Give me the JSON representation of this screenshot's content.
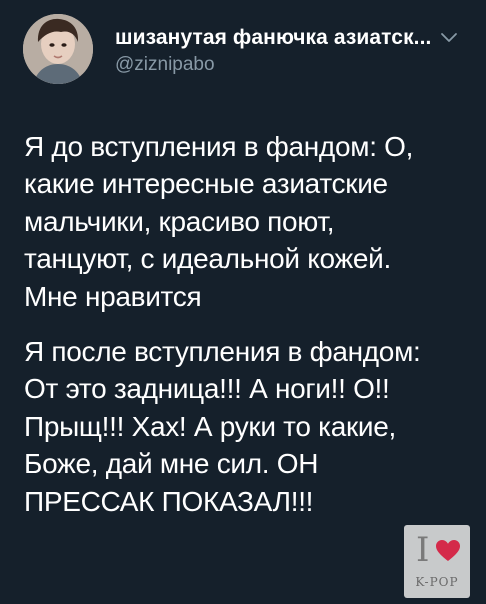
{
  "header": {
    "display_name": "шизанутая фанючка азиатск...",
    "handle": "@ziznipabo",
    "avatar_icon": "user-avatar-photo",
    "menu_icon": "chevron-down-icon"
  },
  "tweet": {
    "paragraph_1": [
      "Я до вступления в фандом: О,",
      "какие интересные азиатские",
      "мальчики, красиво поют,",
      "танцуют, с идеальной кожей.",
      "Мне нравится"
    ],
    "paragraph_2": [
      "Я после вступления в фандом:",
      "От это задница!!! А ноги!! О!!",
      "Прыщ!!! Хах! А руки то какие,",
      "Боже, дай мне сил. ОН",
      "ПРЕССАК ПОКАЗАЛ!!!"
    ]
  },
  "watermark": {
    "letter": "I",
    "icon": "heart-icon",
    "text": "K-POP",
    "heart_color": "#d42a4a"
  },
  "colors": {
    "background": "#15202b",
    "text_primary": "#ffffff",
    "text_secondary": "#8899a6"
  }
}
